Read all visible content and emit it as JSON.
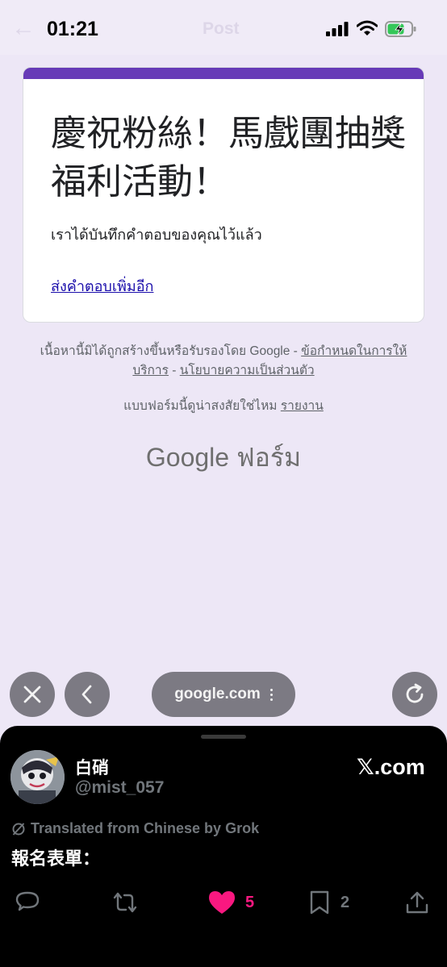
{
  "status_bar": {
    "time": "01:21",
    "ghost_title": "Post"
  },
  "form": {
    "title": "慶祝粉絲！馬戲團抽獎福利活動！",
    "confirmation": "เราได้บันทึกคำตอบของคุณไว้แล้ว",
    "resubmit_link": "ส่งคำตอบเพิ่มอีก",
    "accent_color": "#673ab7"
  },
  "footer": {
    "disclaimer_prefix": "เนื้อหานี้มิได้ถูกสร้างขึ้นหรือรับรองโดย Google - ",
    "terms_link": "ข้อกำหนดในการให้บริการ",
    "separator": " - ",
    "privacy_link": "นโยบายความเป็นส่วนตัว",
    "report_prefix": "แบบฟอร์มนี้ดูน่าสงสัยใช่ไหม ",
    "report_link": "รายงาน",
    "logo_google": "Google",
    "logo_forms": "ฟอร์ม"
  },
  "browser": {
    "url": "google.com",
    "close_icon": "close-icon",
    "back_icon": "chevron-left-icon",
    "reload_icon": "reload-icon",
    "control_color": "#7c7a83"
  },
  "tweet": {
    "display_name": "白硝",
    "handle": "@mist_057",
    "site": "𝕏.com",
    "translation_note": "Translated from Chinese by Grok",
    "text": "報名表單：",
    "like_count": "5",
    "bookmark_count": "2",
    "like_color": "#f91880"
  }
}
